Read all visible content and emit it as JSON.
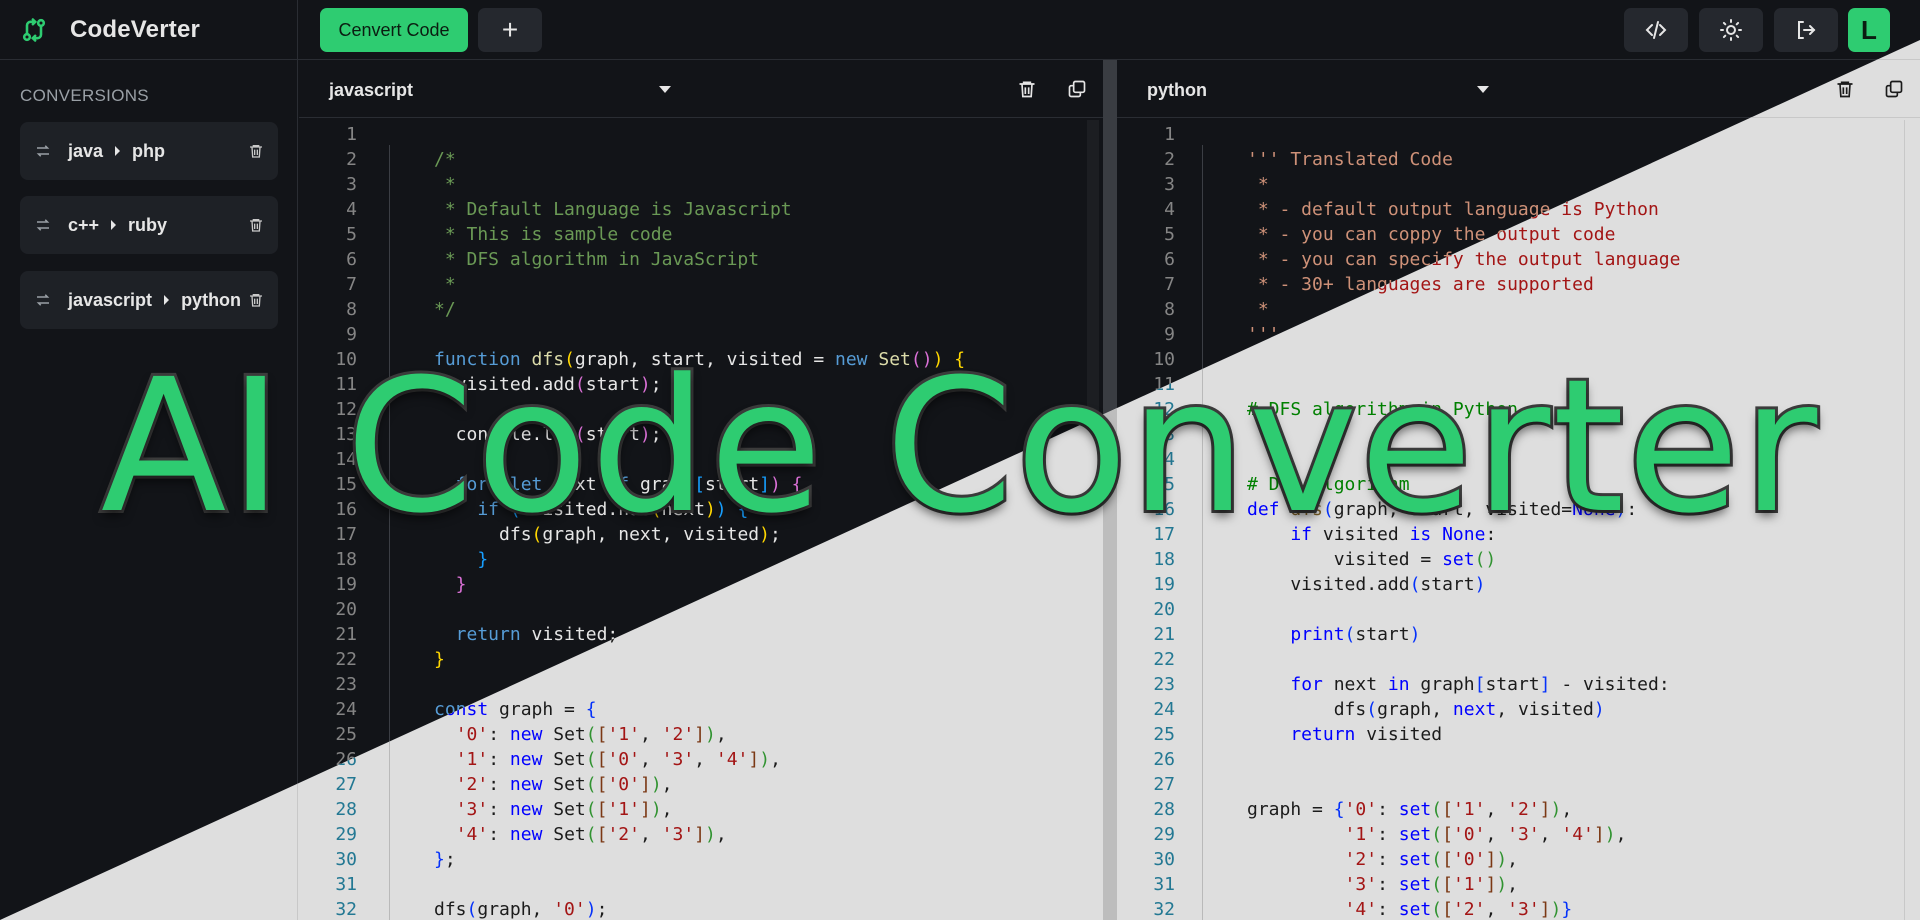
{
  "app": {
    "name": "CodeVerter"
  },
  "header": {
    "convert_label": "Cenvert Code",
    "add_label": "+",
    "avatar_letter": "L"
  },
  "sidebar": {
    "title": "CONVERSIONS",
    "items": [
      {
        "from": "java",
        "to": "php"
      },
      {
        "from": "c++",
        "to": "ruby"
      },
      {
        "from": "javascript",
        "to": "python"
      }
    ]
  },
  "left_editor": {
    "language": "javascript"
  },
  "right_editor": {
    "language": "python"
  },
  "overlay_title": "AI Code Converter",
  "colors": {
    "accent": "#2ecc71",
    "dark_bg": "#121418",
    "light_bg": "#dedede"
  },
  "left_code": [
    [
      {
        "t": "",
        "c": ""
      }
    ],
    [
      {
        "t": "/*",
        "c": "cm"
      }
    ],
    [
      {
        "t": " *",
        "c": "cm"
      }
    ],
    [
      {
        "t": " * Default Language is Javascript",
        "c": "cm"
      }
    ],
    [
      {
        "t": " * This is sample code",
        "c": "cm"
      }
    ],
    [
      {
        "t": " * DFS algorithm in JavaScript",
        "c": "cm"
      }
    ],
    [
      {
        "t": " *",
        "c": "cm"
      }
    ],
    [
      {
        "t": "*/",
        "c": "cm"
      }
    ],
    [
      {
        "t": "",
        "c": ""
      }
    ],
    [
      {
        "t": "function ",
        "c": "kw"
      },
      {
        "t": "dfs",
        "c": "fn"
      },
      {
        "t": "(",
        "c": "br"
      },
      {
        "t": "graph, start, visited = ",
        "c": ""
      },
      {
        "t": "new ",
        "c": "kw"
      },
      {
        "t": "Set",
        "c": "fn"
      },
      {
        "t": "()",
        "c": "br2"
      },
      {
        "t": ") {",
        "c": "br"
      }
    ],
    [
      {
        "t": "  visited.add",
        "c": ""
      },
      {
        "t": "(",
        "c": "br2"
      },
      {
        "t": "start",
        "c": ""
      },
      {
        "t": ")",
        "c": "br2"
      },
      {
        "t": ";",
        "c": ""
      }
    ],
    [
      {
        "t": "",
        "c": ""
      }
    ],
    [
      {
        "t": "  console.log",
        "c": ""
      },
      {
        "t": "(",
        "c": "br2"
      },
      {
        "t": "start",
        "c": ""
      },
      {
        "t": ")",
        "c": "br2"
      },
      {
        "t": ";",
        "c": ""
      }
    ],
    [
      {
        "t": "",
        "c": ""
      }
    ],
    [
      {
        "t": "  for ",
        "c": "kw"
      },
      {
        "t": "(",
        "c": "br2"
      },
      {
        "t": "let ",
        "c": "kw"
      },
      {
        "t": "next ",
        "c": ""
      },
      {
        "t": "of ",
        "c": "kw"
      },
      {
        "t": "graph",
        "c": ""
      },
      {
        "t": "[",
        "c": "br3"
      },
      {
        "t": "start",
        "c": ""
      },
      {
        "t": "]",
        "c": "br3"
      },
      {
        "t": ") {",
        "c": "br2"
      }
    ],
    [
      {
        "t": "    if ",
        "c": "kw"
      },
      {
        "t": "(",
        "c": "br3"
      },
      {
        "t": "!visited.has",
        "c": ""
      },
      {
        "t": "(",
        "c": "br"
      },
      {
        "t": "next",
        "c": ""
      },
      {
        "t": ")",
        "c": "br"
      },
      {
        "t": ") {",
        "c": "br3"
      }
    ],
    [
      {
        "t": "      dfs",
        "c": ""
      },
      {
        "t": "(",
        "c": "br"
      },
      {
        "t": "graph, next, visited",
        "c": ""
      },
      {
        "t": ")",
        "c": "br"
      },
      {
        "t": ";",
        "c": ""
      }
    ],
    [
      {
        "t": "    }",
        "c": "br3"
      }
    ],
    [
      {
        "t": "  }",
        "c": "br2"
      }
    ],
    [
      {
        "t": "",
        "c": ""
      }
    ],
    [
      {
        "t": "  return ",
        "c": "kw"
      },
      {
        "t": "visited;",
        "c": ""
      }
    ],
    [
      {
        "t": "}",
        "c": "br"
      }
    ],
    [
      {
        "t": "",
        "c": ""
      }
    ],
    [
      {
        "t": "const ",
        "c": "kw"
      },
      {
        "t": "graph = ",
        "c": ""
      },
      {
        "t": "{",
        "c": "br"
      }
    ],
    [
      {
        "t": "  ",
        "c": ""
      },
      {
        "t": "'0'",
        "c": "st"
      },
      {
        "t": ": ",
        "c": ""
      },
      {
        "t": "new ",
        "c": "kw"
      },
      {
        "t": "Set",
        "c": ""
      },
      {
        "t": "(",
        "c": "br2"
      },
      {
        "t": "[",
        "c": "br3"
      },
      {
        "t": "'1'",
        "c": "st"
      },
      {
        "t": ", ",
        "c": ""
      },
      {
        "t": "'2'",
        "c": "st"
      },
      {
        "t": "]",
        "c": "br3"
      },
      {
        "t": ")",
        "c": "br2"
      },
      {
        "t": ",",
        "c": ""
      }
    ],
    [
      {
        "t": "  ",
        "c": ""
      },
      {
        "t": "'1'",
        "c": "st"
      },
      {
        "t": ": ",
        "c": ""
      },
      {
        "t": "new ",
        "c": "kw"
      },
      {
        "t": "Set",
        "c": ""
      },
      {
        "t": "(",
        "c": "br2"
      },
      {
        "t": "[",
        "c": "br3"
      },
      {
        "t": "'0'",
        "c": "st"
      },
      {
        "t": ", ",
        "c": ""
      },
      {
        "t": "'3'",
        "c": "st"
      },
      {
        "t": ", ",
        "c": ""
      },
      {
        "t": "'4'",
        "c": "st"
      },
      {
        "t": "]",
        "c": "br3"
      },
      {
        "t": ")",
        "c": "br2"
      },
      {
        "t": ",",
        "c": ""
      }
    ],
    [
      {
        "t": "  ",
        "c": ""
      },
      {
        "t": "'2'",
        "c": "st"
      },
      {
        "t": ": ",
        "c": ""
      },
      {
        "t": "new ",
        "c": "kw"
      },
      {
        "t": "Set",
        "c": ""
      },
      {
        "t": "(",
        "c": "br2"
      },
      {
        "t": "[",
        "c": "br3"
      },
      {
        "t": "'0'",
        "c": "st"
      },
      {
        "t": "]",
        "c": "br3"
      },
      {
        "t": ")",
        "c": "br2"
      },
      {
        "t": ",",
        "c": ""
      }
    ],
    [
      {
        "t": "  ",
        "c": ""
      },
      {
        "t": "'3'",
        "c": "st"
      },
      {
        "t": ": ",
        "c": ""
      },
      {
        "t": "new ",
        "c": "kw"
      },
      {
        "t": "Set",
        "c": ""
      },
      {
        "t": "(",
        "c": "br2"
      },
      {
        "t": "[",
        "c": "br3"
      },
      {
        "t": "'1'",
        "c": "st"
      },
      {
        "t": "]",
        "c": "br3"
      },
      {
        "t": ")",
        "c": "br2"
      },
      {
        "t": ",",
        "c": ""
      }
    ],
    [
      {
        "t": "  ",
        "c": ""
      },
      {
        "t": "'4'",
        "c": "st"
      },
      {
        "t": ": ",
        "c": ""
      },
      {
        "t": "new ",
        "c": "kw"
      },
      {
        "t": "Set",
        "c": ""
      },
      {
        "t": "(",
        "c": "br2"
      },
      {
        "t": "[",
        "c": "br3"
      },
      {
        "t": "'2'",
        "c": "st"
      },
      {
        "t": ", ",
        "c": ""
      },
      {
        "t": "'3'",
        "c": "st"
      },
      {
        "t": "]",
        "c": "br3"
      },
      {
        "t": ")",
        "c": "br2"
      },
      {
        "t": ",",
        "c": ""
      }
    ],
    [
      {
        "t": "}",
        "c": "br"
      },
      {
        "t": ";",
        "c": ""
      }
    ],
    [
      {
        "t": "",
        "c": ""
      }
    ],
    [
      {
        "t": "dfs",
        "c": ""
      },
      {
        "t": "(",
        "c": "br"
      },
      {
        "t": "graph, ",
        "c": ""
      },
      {
        "t": "'0'",
        "c": "st"
      },
      {
        "t": ")",
        "c": "br"
      },
      {
        "t": ";",
        "c": ""
      }
    ]
  ],
  "right_code": [
    [
      {
        "t": "",
        "c": ""
      }
    ],
    [
      {
        "t": "''' Translated Code",
        "c": "py-cm"
      }
    ],
    [
      {
        "t": " *",
        "c": "py-cm"
      }
    ],
    [
      {
        "t": " * - default output language is Python",
        "c": "py-cm"
      }
    ],
    [
      {
        "t": " * - you can coppy the output code",
        "c": "py-cm"
      }
    ],
    [
      {
        "t": " * - you can specify the output language",
        "c": "py-cm"
      }
    ],
    [
      {
        "t": " * - 30+ languages are supported",
        "c": "py-cm"
      }
    ],
    [
      {
        "t": " *",
        "c": "py-cm"
      }
    ],
    [
      {
        "t": "'''",
        "c": "py-cm"
      }
    ],
    [
      {
        "t": "",
        "c": ""
      }
    ],
    [
      {
        "t": "",
        "c": ""
      }
    ],
    [
      {
        "t": "# DFS algorithm in Python",
        "c": "cm"
      }
    ],
    [
      {
        "t": "",
        "c": ""
      }
    ],
    [
      {
        "t": "",
        "c": ""
      }
    ],
    [
      {
        "t": "# DFS algorithm",
        "c": "cm"
      }
    ],
    [
      {
        "t": "def ",
        "c": "kw"
      },
      {
        "t": "dfs",
        "c": "fn"
      },
      {
        "t": "(",
        "c": "br"
      },
      {
        "t": "graph, start, visited=",
        "c": ""
      },
      {
        "t": "None",
        "c": "kw"
      },
      {
        "t": ")",
        "c": "br"
      },
      {
        "t": ":",
        "c": ""
      }
    ],
    [
      {
        "t": "    if ",
        "c": "kw"
      },
      {
        "t": "visited ",
        "c": ""
      },
      {
        "t": "is ",
        "c": "kw"
      },
      {
        "t": "None",
        "c": "kw"
      },
      {
        "t": ":",
        "c": ""
      }
    ],
    [
      {
        "t": "        visited = ",
        "c": ""
      },
      {
        "t": "set",
        "c": "kw"
      },
      {
        "t": "()",
        "c": "br2"
      }
    ],
    [
      {
        "t": "    visited.add",
        "c": ""
      },
      {
        "t": "(",
        "c": "br"
      },
      {
        "t": "start",
        "c": ""
      },
      {
        "t": ")",
        "c": "br"
      }
    ],
    [
      {
        "t": "",
        "c": ""
      }
    ],
    [
      {
        "t": "    ",
        "c": ""
      },
      {
        "t": "print",
        "c": "kw"
      },
      {
        "t": "(",
        "c": "br"
      },
      {
        "t": "start",
        "c": ""
      },
      {
        "t": ")",
        "c": "br"
      }
    ],
    [
      {
        "t": "",
        "c": ""
      }
    ],
    [
      {
        "t": "    ",
        "c": ""
      },
      {
        "t": "for ",
        "c": "kw"
      },
      {
        "t": "next ",
        "c": ""
      },
      {
        "t": "in ",
        "c": "kw"
      },
      {
        "t": "graph",
        "c": ""
      },
      {
        "t": "[",
        "c": "br"
      },
      {
        "t": "start",
        "c": ""
      },
      {
        "t": "]",
        "c": "br"
      },
      {
        "t": " - visited:",
        "c": ""
      }
    ],
    [
      {
        "t": "        dfs",
        "c": ""
      },
      {
        "t": "(",
        "c": "br"
      },
      {
        "t": "graph, ",
        "c": ""
      },
      {
        "t": "next",
        "c": "kw"
      },
      {
        "t": ", visited",
        "c": ""
      },
      {
        "t": ")",
        "c": "br"
      }
    ],
    [
      {
        "t": "    return ",
        "c": "kw"
      },
      {
        "t": "visited",
        "c": ""
      }
    ],
    [
      {
        "t": "",
        "c": ""
      }
    ],
    [
      {
        "t": "",
        "c": ""
      }
    ],
    [
      {
        "t": "graph = ",
        "c": ""
      },
      {
        "t": "{",
        "c": "br"
      },
      {
        "t": "'0'",
        "c": "st"
      },
      {
        "t": ": ",
        "c": ""
      },
      {
        "t": "set",
        "c": "kw"
      },
      {
        "t": "(",
        "c": "br2"
      },
      {
        "t": "[",
        "c": "br3"
      },
      {
        "t": "'1'",
        "c": "st"
      },
      {
        "t": ", ",
        "c": ""
      },
      {
        "t": "'2'",
        "c": "st"
      },
      {
        "t": "]",
        "c": "br3"
      },
      {
        "t": ")",
        "c": "br2"
      },
      {
        "t": ",",
        "c": ""
      }
    ],
    [
      {
        "t": "         ",
        "c": ""
      },
      {
        "t": "'1'",
        "c": "st"
      },
      {
        "t": ": ",
        "c": ""
      },
      {
        "t": "set",
        "c": "kw"
      },
      {
        "t": "(",
        "c": "br2"
      },
      {
        "t": "[",
        "c": "br3"
      },
      {
        "t": "'0'",
        "c": "st"
      },
      {
        "t": ", ",
        "c": ""
      },
      {
        "t": "'3'",
        "c": "st"
      },
      {
        "t": ", ",
        "c": ""
      },
      {
        "t": "'4'",
        "c": "st"
      },
      {
        "t": "]",
        "c": "br3"
      },
      {
        "t": ")",
        "c": "br2"
      },
      {
        "t": ",",
        "c": ""
      }
    ],
    [
      {
        "t": "         ",
        "c": ""
      },
      {
        "t": "'2'",
        "c": "st"
      },
      {
        "t": ": ",
        "c": ""
      },
      {
        "t": "set",
        "c": "kw"
      },
      {
        "t": "(",
        "c": "br2"
      },
      {
        "t": "[",
        "c": "br3"
      },
      {
        "t": "'0'",
        "c": "st"
      },
      {
        "t": "]",
        "c": "br3"
      },
      {
        "t": ")",
        "c": "br2"
      },
      {
        "t": ",",
        "c": ""
      }
    ],
    [
      {
        "t": "         ",
        "c": ""
      },
      {
        "t": "'3'",
        "c": "st"
      },
      {
        "t": ": ",
        "c": ""
      },
      {
        "t": "set",
        "c": "kw"
      },
      {
        "t": "(",
        "c": "br2"
      },
      {
        "t": "[",
        "c": "br3"
      },
      {
        "t": "'1'",
        "c": "st"
      },
      {
        "t": "]",
        "c": "br3"
      },
      {
        "t": ")",
        "c": "br2"
      },
      {
        "t": ",",
        "c": ""
      }
    ],
    [
      {
        "t": "         ",
        "c": ""
      },
      {
        "t": "'4'",
        "c": "st"
      },
      {
        "t": ": ",
        "c": ""
      },
      {
        "t": "set",
        "c": "kw"
      },
      {
        "t": "(",
        "c": "br2"
      },
      {
        "t": "[",
        "c": "br3"
      },
      {
        "t": "'2'",
        "c": "st"
      },
      {
        "t": ", ",
        "c": ""
      },
      {
        "t": "'3'",
        "c": "st"
      },
      {
        "t": "]",
        "c": "br3"
      },
      {
        "t": ")",
        "c": "br2"
      },
      {
        "t": "}",
        "c": "br"
      }
    ]
  ]
}
